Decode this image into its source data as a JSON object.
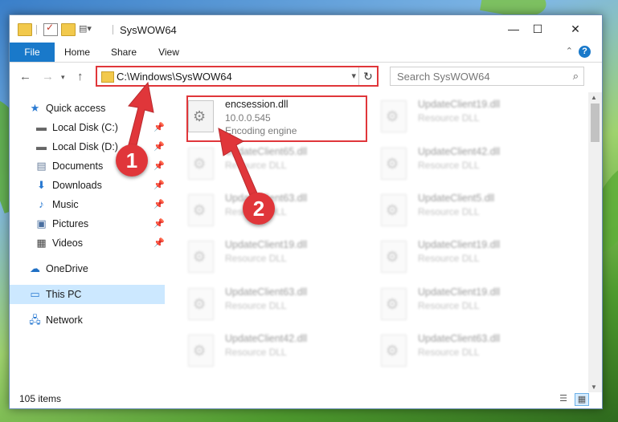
{
  "window": {
    "title": "SysWOW64"
  },
  "ribbon": {
    "tabs": [
      {
        "label": "File"
      },
      {
        "label": "Home"
      },
      {
        "label": "Share"
      },
      {
        "label": "View"
      }
    ],
    "help": "?"
  },
  "address": {
    "path": "C:\\Windows\\SysWOW64"
  },
  "search": {
    "placeholder": "Search SysWOW64"
  },
  "sidebar": {
    "items": [
      {
        "label": "Quick access",
        "icon": "star-icon"
      },
      {
        "label": "Local Disk (C:)",
        "icon": "drive-icon",
        "pinned": true
      },
      {
        "label": "Local Disk (D:)",
        "icon": "drive-icon",
        "pinned": true
      },
      {
        "label": "Documents",
        "icon": "documents-icon",
        "pinned": true
      },
      {
        "label": "Downloads",
        "icon": "downloads-icon",
        "pinned": true
      },
      {
        "label": "Music",
        "icon": "music-icon",
        "pinned": true
      },
      {
        "label": "Pictures",
        "icon": "pictures-icon",
        "pinned": true
      },
      {
        "label": "Videos",
        "icon": "videos-icon",
        "pinned": true
      },
      {
        "label": "OneDrive",
        "icon": "cloud-icon"
      },
      {
        "label": "This PC",
        "icon": "computer-icon",
        "selected": true
      },
      {
        "label": "Network",
        "icon": "network-icon"
      }
    ]
  },
  "files": [
    {
      "name": "encsession.dll",
      "version": "10.0.0.545",
      "desc": "Encoding engine"
    },
    {
      "name": "UpdateClient19.dll",
      "desc": "Resource DLL"
    },
    {
      "name": "UpdateClient65.dll",
      "desc": "Resource DLL"
    },
    {
      "name": "UpdateClient42.dll",
      "desc": "Resource DLL"
    },
    {
      "name": "UpdateClient63.dll",
      "desc": "Resource DLL"
    },
    {
      "name": "UpdateClient5.dll",
      "desc": "Resource DLL"
    },
    {
      "name": "UpdateClient19.dll",
      "desc": "Resource DLL"
    },
    {
      "name": "UpdateClient19.dll",
      "desc": "Resource DLL"
    },
    {
      "name": "UpdateClient63.dll",
      "desc": "Resource DLL"
    },
    {
      "name": "UpdateClient19.dll",
      "desc": "Resource DLL"
    },
    {
      "name": "UpdateClient42.dll",
      "desc": "Resource DLL"
    },
    {
      "name": "UpdateClient63.dll",
      "desc": "Resource DLL"
    }
  ],
  "status": {
    "item_count": "105 items"
  },
  "callouts": [
    "1",
    "2"
  ],
  "colors": {
    "accent": "#1979ca",
    "annotation": "#e0363a",
    "selected": "#cce8ff"
  }
}
